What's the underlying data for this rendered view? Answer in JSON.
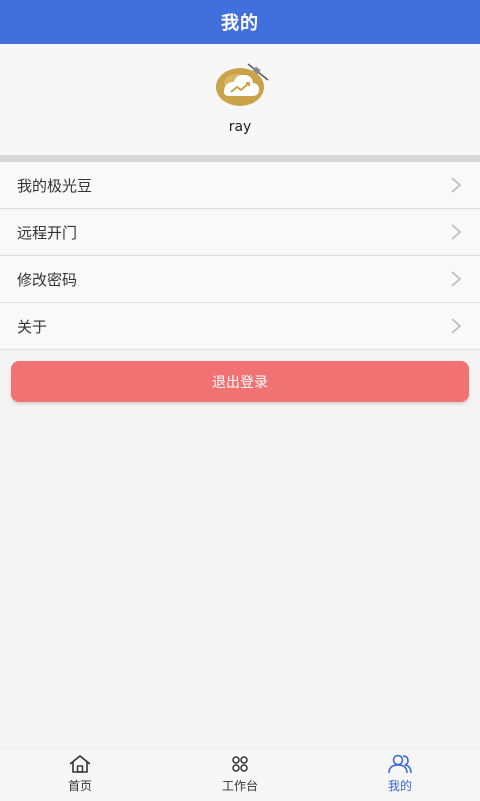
{
  "header": {
    "title": "我的"
  },
  "profile": {
    "username": "ray"
  },
  "menu": {
    "items": [
      {
        "label": "我的极光豆"
      },
      {
        "label": "远程开门"
      },
      {
        "label": "修改密码"
      },
      {
        "label": "关于"
      }
    ]
  },
  "logout": {
    "label": "退出登录"
  },
  "tabbar": {
    "tabs": [
      {
        "label": "首页",
        "icon": "home-icon"
      },
      {
        "label": "工作台",
        "icon": "workbench-icon"
      },
      {
        "label": "我的",
        "icon": "user-icon",
        "active": true
      }
    ]
  },
  "colors": {
    "header": "#4170dc",
    "logout": "#f17272",
    "active_tab": "#3a63d6"
  }
}
